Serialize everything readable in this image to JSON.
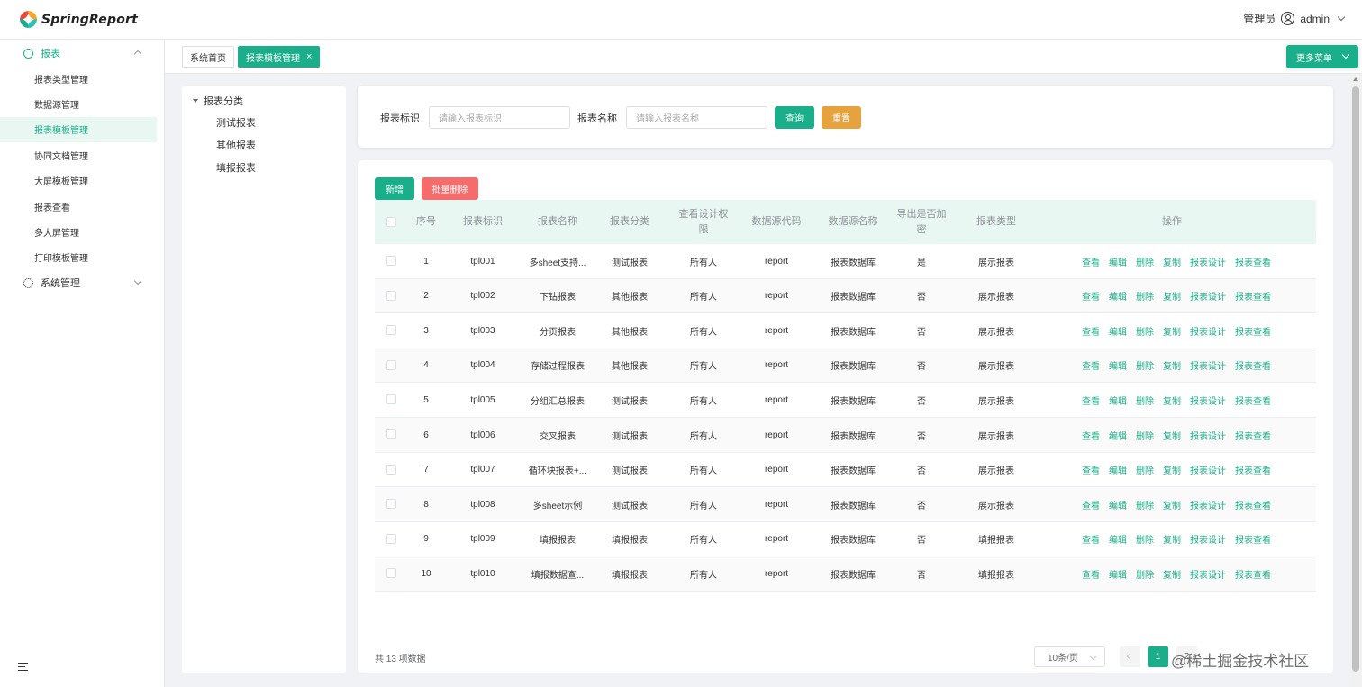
{
  "header": {
    "logo_text": "SpringReport",
    "role": "管理员",
    "username": "admin",
    "colors": {
      "accent": "#1aaf8a",
      "logo_red": "#e8483f",
      "logo_orange": "#f5a623",
      "logo_green": "#1aaf8a",
      "logo_teal": "#2fc0b4"
    }
  },
  "sidebar": {
    "group_report": "报表",
    "items": [
      "报表类型管理",
      "数据源管理",
      "报表模板管理",
      "协同文档管理",
      "大屏模板管理",
      "报表查看",
      "多大屏管理",
      "打印模板管理"
    ],
    "active_index": 2,
    "group_system": "系统管理"
  },
  "tabs": {
    "home": "系统首页",
    "current": "报表模板管理",
    "current_close": "×",
    "more_menu": "更多菜单"
  },
  "tree": {
    "root": "报表分类",
    "children": [
      "测试报表",
      "其他报表",
      "填报报表"
    ]
  },
  "search": {
    "id_label": "报表标识",
    "id_placeholder": "请输入报表标识",
    "name_label": "报表名称",
    "name_placeholder": "请输入报表名称",
    "query": "查询",
    "reset": "重置"
  },
  "toolbar": {
    "add": "新增",
    "batch_delete": "批量删除"
  },
  "table": {
    "columns": [
      "序号",
      "报表标识",
      "报表名称",
      "报表分类",
      "查看设计权限",
      "数据源代码",
      "数据源名称",
      "导出是否加密",
      "报表类型",
      "操作"
    ],
    "col_view_perm_lines": [
      "查看设计权",
      "限"
    ],
    "col_encrypt_lines": [
      "导出是否加",
      "密"
    ],
    "actions": [
      "查看",
      "编辑",
      "删除",
      "复制",
      "报表设计",
      "报表查看"
    ],
    "rows": [
      [
        "1",
        "tpl001",
        "多sheet支持...",
        "测试报表",
        "所有人",
        "report",
        "报表数据库",
        "是",
        "展示报表"
      ],
      [
        "2",
        "tpl002",
        "下钻报表",
        "其他报表",
        "所有人",
        "report",
        "报表数据库",
        "否",
        "展示报表"
      ],
      [
        "3",
        "tpl003",
        "分页报表",
        "其他报表",
        "所有人",
        "report",
        "报表数据库",
        "否",
        "展示报表"
      ],
      [
        "4",
        "tpl004",
        "存储过程报表",
        "其他报表",
        "所有人",
        "report",
        "报表数据库",
        "否",
        "展示报表"
      ],
      [
        "5",
        "tpl005",
        "分组汇总报表",
        "测试报表",
        "所有人",
        "report",
        "报表数据库",
        "否",
        "展示报表"
      ],
      [
        "6",
        "tpl006",
        "交叉报表",
        "测试报表",
        "所有人",
        "report",
        "报表数据库",
        "否",
        "展示报表"
      ],
      [
        "7",
        "tpl007",
        "循环块报表+...",
        "测试报表",
        "所有人",
        "report",
        "报表数据库",
        "否",
        "展示报表"
      ],
      [
        "8",
        "tpl008",
        "多sheet示例",
        "测试报表",
        "所有人",
        "report",
        "报表数据库",
        "否",
        "展示报表"
      ],
      [
        "9",
        "tpl009",
        "填报报表",
        "填报报表",
        "所有人",
        "report",
        "报表数据库",
        "否",
        "填报报表"
      ],
      [
        "10",
        "tpl010",
        "填报数据查...",
        "填报报表",
        "所有人",
        "report",
        "报表数据库",
        "否",
        "填报报表"
      ]
    ]
  },
  "pagination": {
    "total": "共 13 项数据",
    "page_size": "10条/页",
    "pages": [
      "1",
      "2"
    ],
    "current": "1"
  },
  "watermark": "@稀土掘金技术社区"
}
